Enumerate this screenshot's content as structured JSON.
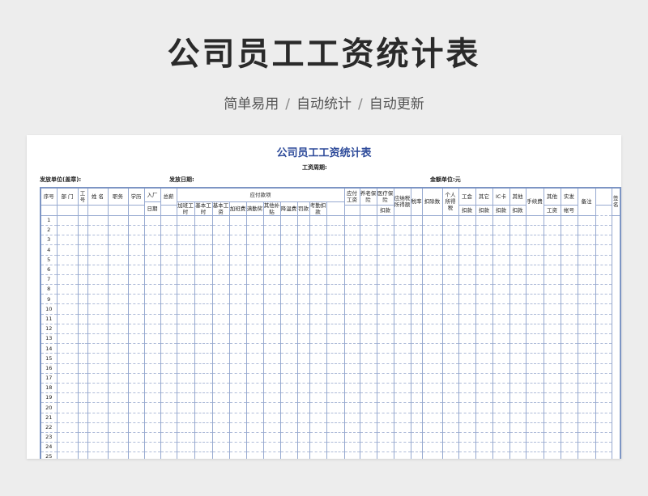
{
  "hero": {
    "title": "公司员工工资统计表",
    "subtitle": [
      "简单易用",
      "自动统计",
      "自动更新"
    ]
  },
  "sheet": {
    "title": "公司员工工资统计表",
    "period_label": "工资周期:",
    "issuer_label": "发放单位(盖章):",
    "date_label": "发放日期:",
    "amount_unit_label": "金额单位:元",
    "group_header": "应付款项",
    "columns": {
      "seq": "序号",
      "dept": "部 门",
      "empno": "工号",
      "name": "姓 名",
      "position": "职务",
      "education": "学历",
      "join_top": "入厂",
      "join_bottom": "日期",
      "total": "总薪",
      "overtime_hours": "加班工时",
      "base_hours": "基本工时",
      "base_wage": "基本工资",
      "overtime_pay": "加班费",
      "attendance_bonus": "满勤奖",
      "other_allow": "其他补贴",
      "cooling_fee": "降温费",
      "fine": "罚款",
      "attendance_deduct": "考勤扣款",
      "payable_wage": "应付工资",
      "pension": "养老保险",
      "medical": "医疗保险",
      "taxable_income": "应纳税所得额",
      "tax_rate": "税率",
      "deduction_count": "扣除数",
      "personal_tax": "个人所得税",
      "union_top": "工会",
      "union_bottom": "扣款",
      "other_top": "其它",
      "other_bottom": "扣款",
      "ic_top": "IC卡",
      "ic_bottom": "扣款",
      "other2_top": "其他",
      "other2_bottom": "扣款",
      "fee": "手续费",
      "other3_top": "其他",
      "other3_bottom": "扣款",
      "actual_top": "实发",
      "actual_bottom": "工资",
      "remark": "备注",
      "account": "帐号",
      "signature": "签名"
    },
    "row_numbers": [
      "1",
      "2",
      "3",
      "4",
      "5",
      "6",
      "7",
      "8",
      "9",
      "10",
      "11",
      "12",
      "13",
      "14",
      "15",
      "16",
      "17",
      "18",
      "19",
      "20",
      "21",
      "22",
      "23",
      "24",
      "25"
    ]
  }
}
